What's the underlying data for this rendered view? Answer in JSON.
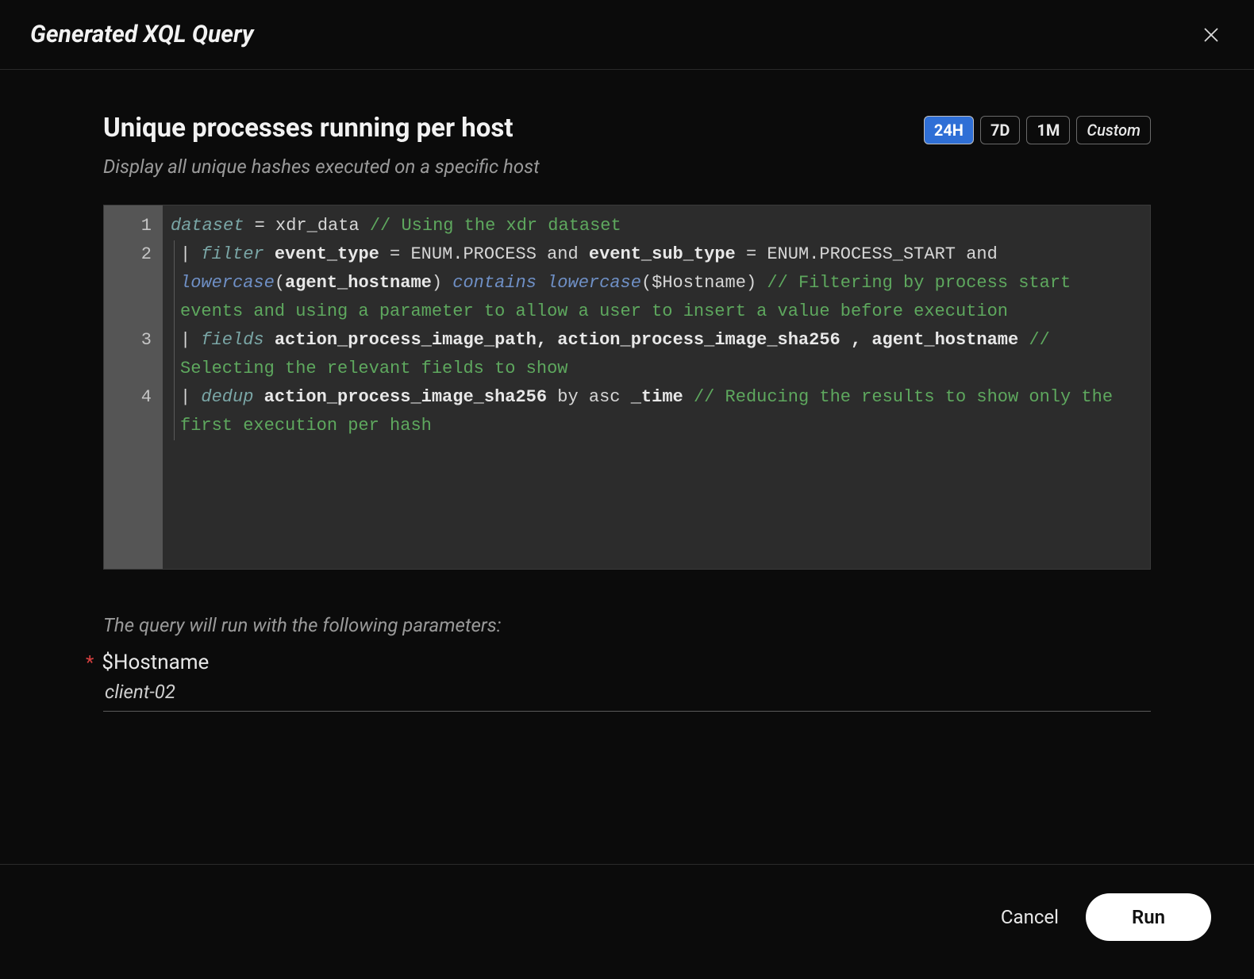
{
  "modal": {
    "title": "Generated XQL Query",
    "close_icon": "close"
  },
  "query": {
    "name": "Unique processes running per host",
    "description": "Display all unique hashes executed on a specific host"
  },
  "timerange": {
    "options": [
      "24H",
      "7D",
      "1M",
      "Custom"
    ],
    "active": "24H"
  },
  "code": {
    "line_numbers": [
      "1",
      "2",
      "3",
      "4"
    ],
    "l1": {
      "kw": "dataset",
      "eq": " = ",
      "val": "xdr_data ",
      "cmt": "// Using the xdr dataset"
    },
    "l2": {
      "pipe": "| ",
      "kw": "filter",
      "sp1": " ",
      "id1": "event_type",
      "mid1": " = ENUM.PROCESS and ",
      "id2": "event_sub_type",
      "mid2": " = ENUM.PROCESS_START and ",
      "fn1": "lowercase",
      "open1": "(",
      "id3": "agent_hostname",
      "close1": ") ",
      "fn2": "contains",
      "sp2": " ",
      "fn3": "lowercase",
      "open2": "($Hostname) ",
      "cmt": "// Filtering by process start events and using a parameter to allow a user to insert a value before execution"
    },
    "l3": {
      "pipe": "| ",
      "kw": "fields",
      "sp": " ",
      "id1": "action_process_image_path, action_process_image_sha256 , agent_hostname",
      "sp2": " ",
      "cmt": "// Selecting the relevant fields to show"
    },
    "l4": {
      "pipe": "| ",
      "kw": "dedup",
      "sp": " ",
      "id1": "action_process_image_sha256",
      "mid": " by asc ",
      "id2": "_time",
      "sp2": " ",
      "cmt": "// Reducing the results to show only the first execution per hash"
    }
  },
  "params": {
    "intro": "The query will run with the following parameters:",
    "items": [
      {
        "name": "$Hostname",
        "value": "client-02",
        "required": true
      }
    ]
  },
  "footer": {
    "cancel": "Cancel",
    "run": "Run"
  }
}
